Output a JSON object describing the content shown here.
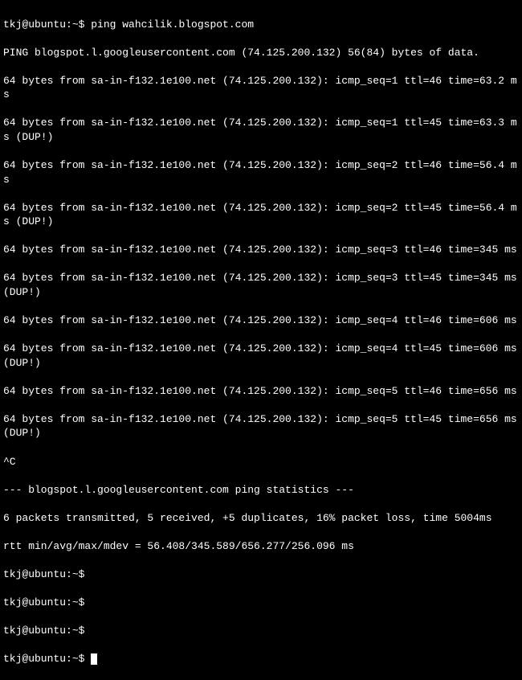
{
  "terminal": {
    "prompt": "tkj@ubuntu:~$",
    "command": "ping wahcilik.blogspot.com",
    "ping_header": "PING blogspot.l.googleusercontent.com (74.125.200.132) 56(84) bytes of data.",
    "responses": [
      "64 bytes from sa-in-f132.1e100.net (74.125.200.132): icmp_seq=1 ttl=46 time=63.2 ms",
      "64 bytes from sa-in-f132.1e100.net (74.125.200.132): icmp_seq=1 ttl=45 time=63.3 ms (DUP!)",
      "64 bytes from sa-in-f132.1e100.net (74.125.200.132): icmp_seq=2 ttl=46 time=56.4 ms",
      "64 bytes from sa-in-f132.1e100.net (74.125.200.132): icmp_seq=2 ttl=45 time=56.4 ms (DUP!)",
      "64 bytes from sa-in-f132.1e100.net (74.125.200.132): icmp_seq=3 ttl=46 time=345 ms",
      "64 bytes from sa-in-f132.1e100.net (74.125.200.132): icmp_seq=3 ttl=45 time=345 ms (DUP!)",
      "64 bytes from sa-in-f132.1e100.net (74.125.200.132): icmp_seq=4 ttl=46 time=606 ms",
      "64 bytes from sa-in-f132.1e100.net (74.125.200.132): icmp_seq=4 ttl=45 time=606 ms (DUP!)",
      "64 bytes from sa-in-f132.1e100.net (74.125.200.132): icmp_seq=5 ttl=46 time=656 ms",
      "64 bytes from sa-in-f132.1e100.net (74.125.200.132): icmp_seq=5 ttl=45 time=656 ms (DUP!)"
    ],
    "interrupt": "^C",
    "stats_header": "--- blogspot.l.googleusercontent.com ping statistics ---",
    "stats_summary": "6 packets transmitted, 5 received, +5 duplicates, 16% packet loss, time 5004ms",
    "rtt": "rtt min/avg/max/mdev = 56.408/345.589/656.277/256.096 ms"
  }
}
